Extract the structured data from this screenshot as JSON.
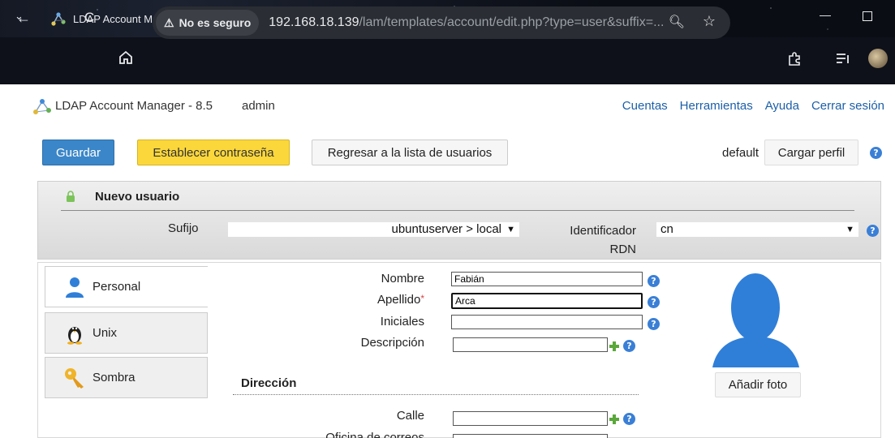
{
  "browser": {
    "tab_title": "LDAP Account Manager (localho",
    "security_label": "No es seguro",
    "url_host": "192.168.18.139",
    "url_path": "/lam/templates/account/edit.php?type=user&suffix=..."
  },
  "app": {
    "title": "LDAP Account Manager - 8.5",
    "user": "admin",
    "nav": [
      "Cuentas",
      "Herramientas",
      "Ayuda",
      "Cerrar sesión"
    ]
  },
  "actions": {
    "save": "Guardar",
    "set_password": "Establecer contraseña",
    "back_to_list": "Regresar a la lista de usuarios",
    "profile_name": "default",
    "load_profile": "Cargar perfil"
  },
  "panel": {
    "title": "Nuevo usuario",
    "suffix_label": "Sufijo",
    "suffix_value": "ubuntuserver > local",
    "rdn_label": "Identificador RDN",
    "rdn_value": "cn"
  },
  "tabs": [
    "Personal",
    "Unix",
    "Sombra"
  ],
  "form": {
    "first_name_label": "Nombre",
    "first_name_value": "Fabián",
    "last_name_label": "Apellido",
    "last_name_value": "Arca",
    "initials_label": "Iniciales",
    "initials_value": "",
    "description_label": "Descripción",
    "description_value": "",
    "address_section": "Dirección",
    "street_label": "Calle",
    "street_value": "",
    "postbox_label": "Oficina de correos"
  },
  "photo": {
    "add_label": "Añadir foto"
  },
  "colors": {
    "save_button": "#3b86c8",
    "password_button": "#fbd73b",
    "link": "#1b5fa8",
    "help_icon": "#3a7fd6"
  }
}
